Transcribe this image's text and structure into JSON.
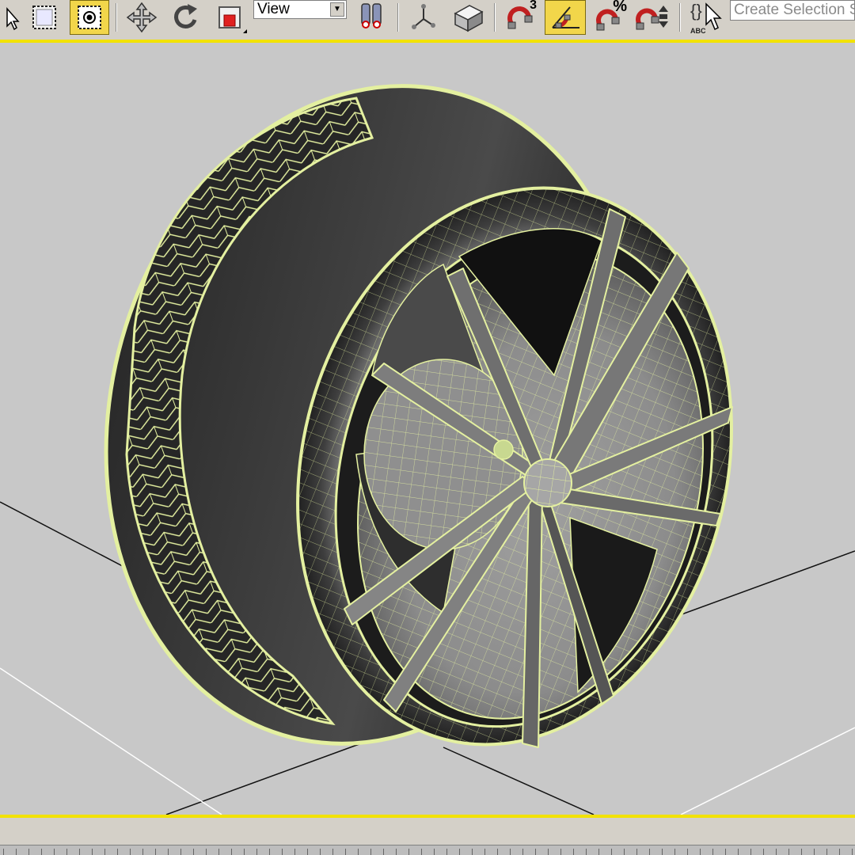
{
  "toolbar": {
    "icons": [
      "select-cursor-icon",
      "select-region-icon",
      "window-crossing-icon",
      "move-icon",
      "rotate-icon",
      "scale-icon",
      "view-dropdown",
      "mirror-icon",
      "pivot-icon",
      "snaps-3d-icon",
      "angle-snap-icon",
      "percent-snap-icon",
      "spinner-snap-icon",
      "named-selection-icon"
    ],
    "reference_coord_system": "View",
    "snap_toggle_label": "3",
    "percent_snap_label": "%",
    "named_selection_badge": "ABC",
    "selection_set_placeholder": "Create Selection S",
    "active_button_color": "#f2d64a"
  },
  "viewport": {
    "active_border_color": "#f2e200",
    "background_color": "#c8c8c8",
    "wireframe_color": "#e4f0a0",
    "object": "wheel"
  }
}
